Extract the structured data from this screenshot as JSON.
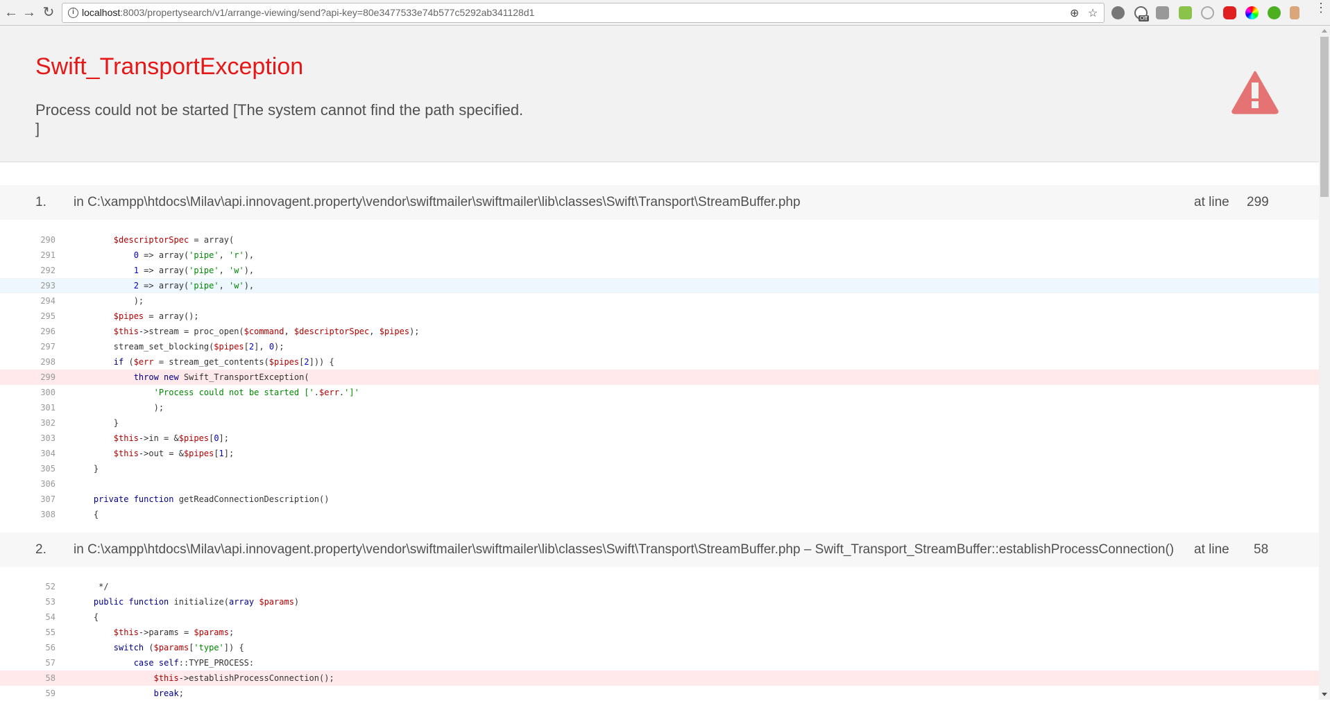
{
  "browser": {
    "url_host": "localhost",
    "url_rest": ":8003/propertysearch/v1/arrange-viewing/send?api-key=80e3477533e74b577c5292ab341128d1",
    "back_icon": "←",
    "forward_icon": "→",
    "reload_icon": "↻",
    "info_icon": "i",
    "zoom_icon": "⊕",
    "star_icon": "☆",
    "ext_badge": "Off",
    "menu_icon": "⋮"
  },
  "error": {
    "title": "Swift_TransportException",
    "message": "Process could not be started [The system cannot find the path specified.\n]",
    "accent": "#e51717"
  },
  "frames": [
    {
      "index": "1.",
      "path": "in C:\\xampp\\htdocs\\Milav\\api.innovagent.property\\vendor\\swiftmailer\\swiftmailer\\lib\\classes\\Swift\\Transport\\StreamBuffer.php",
      "at_line_label": "at line",
      "line": "299",
      "code": [
        {
          "n": "290",
          "t": [
            [
              "p",
              "        "
            ],
            [
              "v",
              "$descriptorSpec"
            ],
            [
              "p",
              " = "
            ],
            [
              "f",
              "array("
            ]
          ]
        },
        {
          "n": "291",
          "t": [
            [
              "p",
              "            "
            ],
            [
              "n",
              "0"
            ],
            [
              "p",
              " => "
            ],
            [
              "f",
              "array("
            ],
            [
              "s",
              "'pipe'"
            ],
            [
              "p",
              ", "
            ],
            [
              "s",
              "'r'"
            ],
            [
              "p",
              "),"
            ]
          ]
        },
        {
          "n": "292",
          "t": [
            [
              "p",
              "            "
            ],
            [
              "n",
              "1"
            ],
            [
              "p",
              " => "
            ],
            [
              "f",
              "array("
            ],
            [
              "s",
              "'pipe'"
            ],
            [
              "p",
              ", "
            ],
            [
              "s",
              "'w'"
            ],
            [
              "p",
              "),"
            ]
          ]
        },
        {
          "n": "293",
          "hl": "hov",
          "t": [
            [
              "p",
              "            "
            ],
            [
              "n",
              "2"
            ],
            [
              "p",
              " => "
            ],
            [
              "f",
              "array("
            ],
            [
              "s",
              "'pipe'"
            ],
            [
              "p",
              ", "
            ],
            [
              "s",
              "'w'"
            ],
            [
              "p",
              "),"
            ]
          ]
        },
        {
          "n": "294",
          "t": [
            [
              "p",
              "            );"
            ]
          ]
        },
        {
          "n": "295",
          "t": [
            [
              "p",
              "        "
            ],
            [
              "v",
              "$pipes"
            ],
            [
              "p",
              " = "
            ],
            [
              "f",
              "array();"
            ]
          ]
        },
        {
          "n": "296",
          "t": [
            [
              "p",
              "        "
            ],
            [
              "v",
              "$this"
            ],
            [
              "p",
              "->stream = proc_open("
            ],
            [
              "v",
              "$command"
            ],
            [
              "p",
              ", "
            ],
            [
              "v",
              "$descriptorSpec"
            ],
            [
              "p",
              ", "
            ],
            [
              "v",
              "$pipes"
            ],
            [
              "p",
              ");"
            ]
          ]
        },
        {
          "n": "297",
          "t": [
            [
              "p",
              "        stream_set_blocking("
            ],
            [
              "v",
              "$pipes"
            ],
            [
              "p",
              "["
            ],
            [
              "n",
              "2"
            ],
            [
              "p",
              "], "
            ],
            [
              "n",
              "0"
            ],
            [
              "p",
              ");"
            ]
          ]
        },
        {
          "n": "298",
          "t": [
            [
              "p",
              "        "
            ],
            [
              "k",
              "if"
            ],
            [
              "p",
              " ("
            ],
            [
              "v",
              "$err"
            ],
            [
              "p",
              " = stream_get_contents("
            ],
            [
              "v",
              "$pipes"
            ],
            [
              "p",
              "["
            ],
            [
              "n",
              "2"
            ],
            [
              "p",
              "])) {"
            ]
          ]
        },
        {
          "n": "299",
          "hl": "err",
          "t": [
            [
              "p",
              "            "
            ],
            [
              "k",
              "throw new"
            ],
            [
              "p",
              " Swift_TransportException("
            ]
          ]
        },
        {
          "n": "300",
          "t": [
            [
              "p",
              "                "
            ],
            [
              "s",
              "'Process could not be started ['"
            ],
            [
              "p",
              "."
            ],
            [
              "v",
              "$err"
            ],
            [
              "p",
              "."
            ],
            [
              "s",
              "']'"
            ]
          ]
        },
        {
          "n": "301",
          "t": [
            [
              "p",
              "                );"
            ]
          ]
        },
        {
          "n": "302",
          "t": [
            [
              "p",
              "        }"
            ]
          ]
        },
        {
          "n": "303",
          "t": [
            [
              "p",
              "        "
            ],
            [
              "v",
              "$this"
            ],
            [
              "p",
              "->in = &"
            ],
            [
              "v",
              "$pipes"
            ],
            [
              "p",
              "["
            ],
            [
              "n",
              "0"
            ],
            [
              "p",
              "];"
            ]
          ]
        },
        {
          "n": "304",
          "t": [
            [
              "p",
              "        "
            ],
            [
              "v",
              "$this"
            ],
            [
              "p",
              "->out = &"
            ],
            [
              "v",
              "$pipes"
            ],
            [
              "p",
              "["
            ],
            [
              "n",
              "1"
            ],
            [
              "p",
              "];"
            ]
          ]
        },
        {
          "n": "305",
          "t": [
            [
              "p",
              "    }"
            ]
          ]
        },
        {
          "n": "306",
          "t": []
        },
        {
          "n": "307",
          "t": [
            [
              "p",
              "    "
            ],
            [
              "k",
              "private function"
            ],
            [
              "p",
              " getReadConnectionDescription()"
            ]
          ]
        },
        {
          "n": "308",
          "t": [
            [
              "p",
              "    {"
            ]
          ]
        }
      ]
    },
    {
      "index": "2.",
      "path": "in C:\\xampp\\htdocs\\Milav\\api.innovagent.property\\vendor\\swiftmailer\\swiftmailer\\lib\\classes\\Swift\\Transport\\StreamBuffer.php – Swift_Transport_StreamBuffer::establishProcessConnection()",
      "at_line_label": "at line",
      "line": "58",
      "code": [
        {
          "n": "52",
          "t": [
            [
              "p",
              "     */"
            ]
          ]
        },
        {
          "n": "53",
          "t": [
            [
              "p",
              "    "
            ],
            [
              "k",
              "public function"
            ],
            [
              "p",
              " initialize("
            ],
            [
              "k",
              "array"
            ],
            [
              "p",
              " "
            ],
            [
              "v",
              "$params"
            ],
            [
              "p",
              ")"
            ]
          ]
        },
        {
          "n": "54",
          "t": [
            [
              "p",
              "    {"
            ]
          ]
        },
        {
          "n": "55",
          "t": [
            [
              "p",
              "        "
            ],
            [
              "v",
              "$this"
            ],
            [
              "p",
              "->params = "
            ],
            [
              "v",
              "$params"
            ],
            [
              "p",
              ";"
            ]
          ]
        },
        {
          "n": "56",
          "t": [
            [
              "p",
              "        "
            ],
            [
              "k",
              "switch"
            ],
            [
              "p",
              " ("
            ],
            [
              "v",
              "$params"
            ],
            [
              "p",
              "["
            ],
            [
              "s",
              "'type'"
            ],
            [
              "p",
              "]) {"
            ]
          ]
        },
        {
          "n": "57",
          "t": [
            [
              "p",
              "            "
            ],
            [
              "k",
              "case"
            ],
            [
              "p",
              " "
            ],
            [
              "k",
              "self"
            ],
            [
              "p",
              "::TYPE_PROCESS:"
            ]
          ]
        },
        {
          "n": "58",
          "hl": "err",
          "t": [
            [
              "p",
              "                "
            ],
            [
              "v",
              "$this"
            ],
            [
              "p",
              "->establishProcessConnection();"
            ]
          ]
        },
        {
          "n": "59",
          "t": [
            [
              "p",
              "                "
            ],
            [
              "k",
              "break"
            ],
            [
              "p",
              ";"
            ]
          ]
        }
      ]
    }
  ]
}
